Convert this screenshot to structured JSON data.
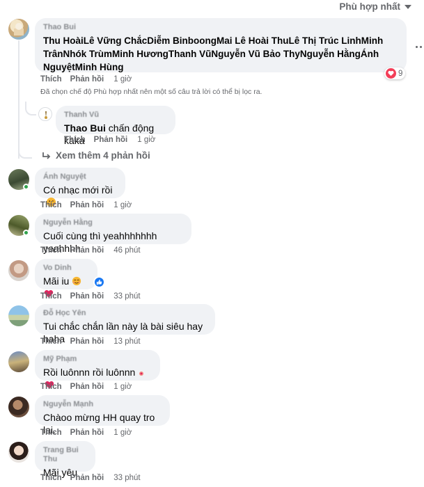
{
  "sort_label": "Phù hợp nhất",
  "action_labels": {
    "like": "Thích",
    "reply": "Phản hồi"
  },
  "filter_note": "Đã chọn chế độ Phù hợp nhất nên một số câu trả lời có thể bị lọc ra.",
  "see_more_replies": "Xem thêm 4 phản hồi",
  "top_comment": {
    "author": "Thao Bui",
    "text": "Thu HoàiLê Vững ChắcDiễm BinboongMai Lê Hoài ThuLê Thị Trúc LinhMinh TrânNhók TrùmMinh HươngThanh VũNguyễn Vũ Bảo ThyNguyễn HằngÁnh NguyệtMinh Hùng",
    "time": "1 giờ",
    "reaction_count": "9"
  },
  "reply": {
    "author": "Thanh Vũ",
    "mention": "Thao Bui",
    "text": " chấn động kaka",
    "time": "1 giờ"
  },
  "comments": [
    {
      "author": "Ánh Nguyệt",
      "text": "Có nhạc mới rồi",
      "time": "1 giờ"
    },
    {
      "author": "Nguyễn Hằng",
      "text": "Cuối cùng thì yeahhhhhhh yeahhhh",
      "time": "46 phút"
    },
    {
      "author": "Vo Dinh",
      "text": "Mãi iu",
      "time": "33 phút"
    },
    {
      "author": "Đỗ Học Yên",
      "text": "Tui chắc chắn lần này là bài siêu hay haha",
      "time": "13 phút"
    },
    {
      "author": "Mỹ Phạm",
      "text": "Rồi luônnn rồi luônnn",
      "time": "1 giờ"
    },
    {
      "author": "Nguyễn Mạnh",
      "text": "Chàoo mừng HH quay tro lai.",
      "time": "1 giờ"
    },
    {
      "author": "Trang Bui Thu",
      "text": "Mãi yêu",
      "time": "33 phút"
    }
  ],
  "colors": {
    "bubble": "#f0f2f5",
    "secondary_text": "#65676b",
    "heart": "#f33e58",
    "like_blue": "#1877f2",
    "online": "#31a24c"
  }
}
